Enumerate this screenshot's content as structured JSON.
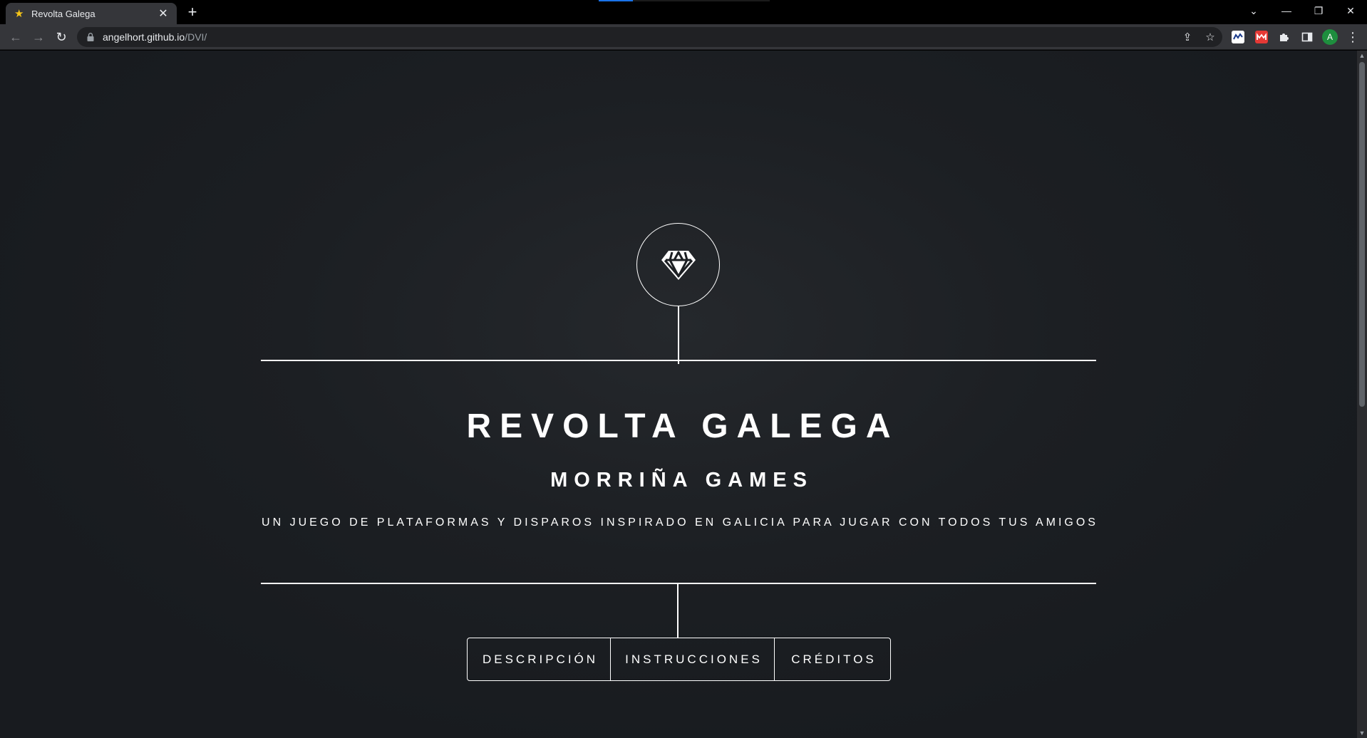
{
  "browser": {
    "tab": {
      "title": "Revolta Galega",
      "favicon": "star-icon",
      "close_glyph": "✕"
    },
    "new_tab_glyph": "+",
    "url": {
      "host": "angelhort.github.io",
      "path": "/DVI/"
    },
    "window_controls": {
      "tab_search": "⌄",
      "minimize": "—",
      "restore": "❐",
      "close": "✕"
    },
    "nav": {
      "back": "←",
      "forward": "→",
      "reload": "↻"
    },
    "omnibox_icons": {
      "share": "⇪",
      "bookmark": "☆"
    },
    "extensions": [
      {
        "name": "extension-1-icon",
        "color": "#1a73e8"
      },
      {
        "name": "extension-2-icon",
        "color": "#e53935"
      },
      {
        "name": "puzzle-icon"
      },
      {
        "name": "sidepanel-icon"
      }
    ],
    "profile_initial": "A",
    "menu_glyph": "⋮"
  },
  "hero": {
    "icon": "diamond-icon",
    "title": "REVOLTA GALEGA",
    "subtitle": "MORRIÑA GAMES",
    "tagline": "UN JUEGO DE PLATAFORMAS Y DISPAROS INSPIRADO EN GALICIA PARA JUGAR CON TODOS TUS AMIGOS"
  },
  "nav_menu": {
    "items": [
      "DESCRIPCIÓN",
      "INSTRUCCIONES",
      "CRÉDITOS"
    ]
  },
  "colors": {
    "page_bg": "#1c1f23",
    "foreground": "#ffffff",
    "chrome_bg": "#35363a",
    "omnibox_bg": "#202124"
  }
}
